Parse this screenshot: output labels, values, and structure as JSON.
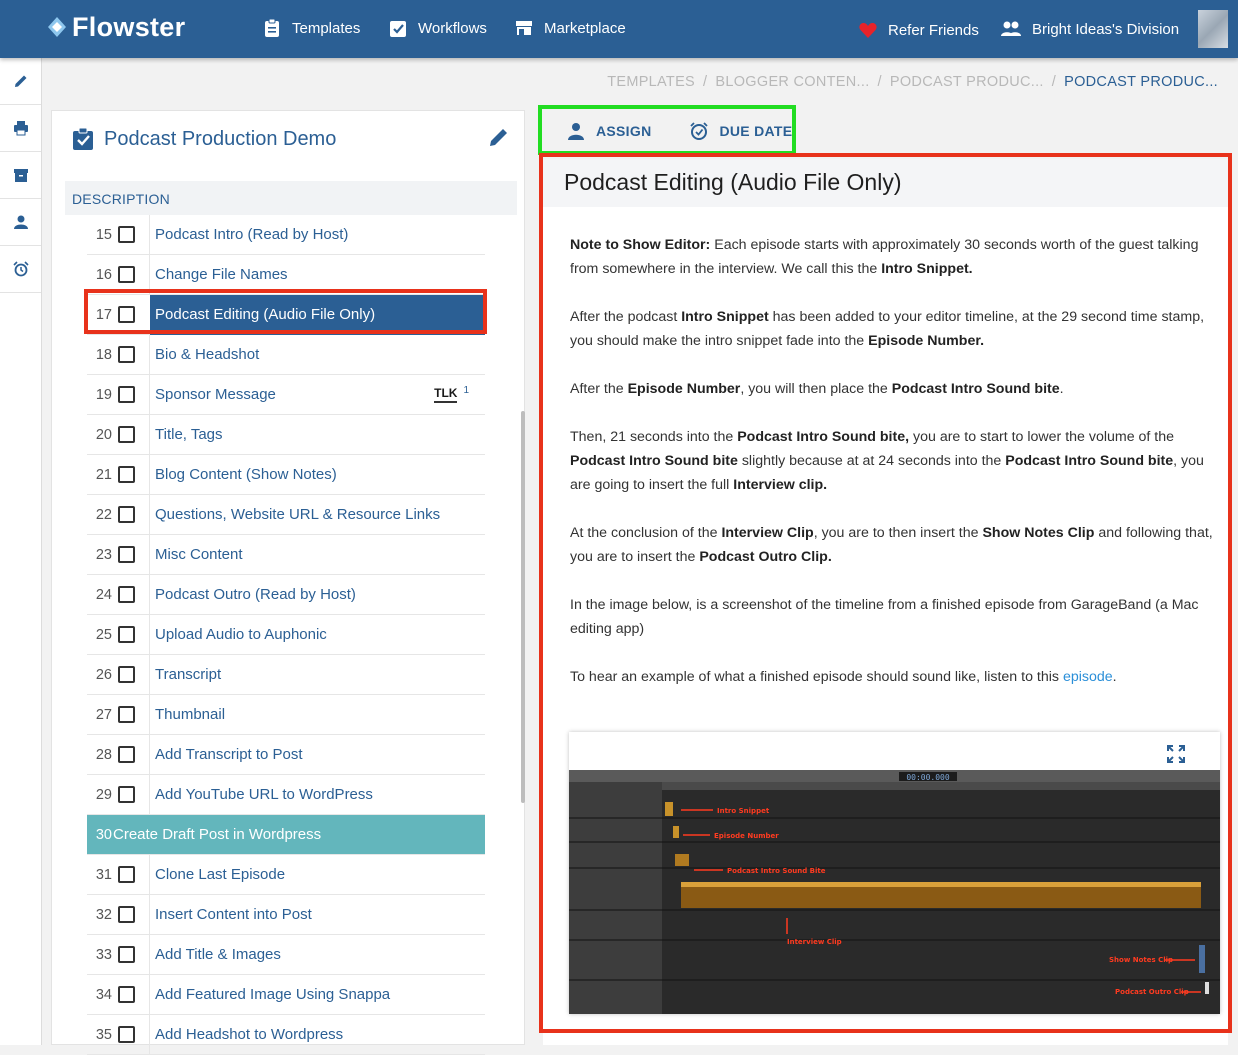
{
  "app": {
    "name": "Flowster"
  },
  "nav": {
    "templates": "Templates",
    "workflows": "Workflows",
    "marketplace": "Marketplace",
    "refer": "Refer Friends",
    "division": "Bright Ideas's Division"
  },
  "breadcrumb": [
    "TEMPLATES",
    "/",
    "BLOGGER CONTEN...",
    "/",
    "PODCAST PRODUC...",
    "/",
    "PODCAST PRODUC..."
  ],
  "left_panel": {
    "title": "Podcast Production Demo",
    "tab": "DESCRIPTION"
  },
  "steps": [
    {
      "num": "15",
      "label": "Podcast Intro (Read by Host)"
    },
    {
      "num": "16",
      "label": "Change File Names"
    },
    {
      "num": "17",
      "label": "Podcast Editing (Audio File Only)"
    },
    {
      "num": "18",
      "label": "Bio & Headshot"
    },
    {
      "num": "19",
      "label": "Sponsor Message",
      "badge": "TLK",
      "badge_count": "1"
    },
    {
      "num": "20",
      "label": "Title, Tags"
    },
    {
      "num": "21",
      "label": "Blog Content (Show Notes)"
    },
    {
      "num": "22",
      "label": "Questions, Website URL & Resource Links"
    },
    {
      "num": "23",
      "label": "Misc Content"
    },
    {
      "num": "24",
      "label": "Podcast Outro (Read by Host)"
    },
    {
      "num": "25",
      "label": "Upload Audio to Auphonic"
    },
    {
      "num": "26",
      "label": "Transcript"
    },
    {
      "num": "27",
      "label": "Thumbnail"
    },
    {
      "num": "28",
      "label": "Add Transcript to Post"
    },
    {
      "num": "29",
      "label": "Add YouTube URL to WordPress"
    },
    {
      "num": "30",
      "label": "Create Draft Post in Wordpress"
    },
    {
      "num": "31",
      "label": "Clone Last Episode"
    },
    {
      "num": "32",
      "label": "Insert Content into Post"
    },
    {
      "num": "33",
      "label": "Add Title & Images"
    },
    {
      "num": "34",
      "label": "Add Featured Image Using Snappa"
    },
    {
      "num": "35",
      "label": "Add Headshot to Wordpress"
    }
  ],
  "actions": {
    "assign": "ASSIGN",
    "due_date": "DUE DATE"
  },
  "task": {
    "title": "Podcast Editing (Audio File Only)",
    "p1_b1": "Note to Show Editor:",
    "p1_t1": " Each episode starts with approximately 30 seconds worth of the guest talking from somewhere in the interview. We call this the ",
    "p1_b2": "Intro Snippet.",
    "p2_t1": "After the podcast ",
    "p2_b1": "Intro Snippet",
    "p2_t2": " has been added to your editor timeline, at the 29 second time stamp, you should make the intro snippet fade into the ",
    "p2_b2": "Episode Number.",
    "p3_t1": "After the ",
    "p3_b1": "Episode Number",
    "p3_t2": ", you will then place the ",
    "p3_b2": "Podcast Intro Sound bite",
    "p3_t3": ".",
    "p4_t1": "Then, 21 seconds into the ",
    "p4_b1": "Podcast Intro Sound bite,",
    "p4_t2": " you are to start to lower the volume of the ",
    "p4_b2": "Podcast Intro Sound bite",
    "p4_t3": " slightly because at at 24 seconds into the ",
    "p4_b3": "Podcast Intro Sound bite",
    "p4_t4": ", you are going to insert the full ",
    "p4_b4": "Interview clip.",
    "p5_t1": "At the conclusion of the ",
    "p5_b1": "Interview Clip",
    "p5_t2": ", you are to then insert the ",
    "p5_b2": "Show Notes Clip",
    "p5_t3": " and following that, you are to insert the ",
    "p5_b3": "Podcast Outro Clip.",
    "p6": "In the image below, is a screenshot of the timeline from a finished episode from GarageBand (a Mac editing app)",
    "p7_t1": "To hear an example of what a finished episode should sound like, listen to this ",
    "p7_link": "episode",
    "p7_t2": "."
  },
  "garageband": {
    "time": "00:00.000",
    "annotations": [
      "Intro Snippet",
      "Episode Number",
      "Podcast Intro Sound Bite",
      "Interview Clip",
      "Show Notes Clip",
      "Podcast Outro Clip"
    ]
  },
  "colors": {
    "brand": "#2b5f94",
    "teal": "#63b6bc",
    "red_box": "#e8321b",
    "green_box": "#22dd22",
    "link": "#2b8fd8"
  }
}
